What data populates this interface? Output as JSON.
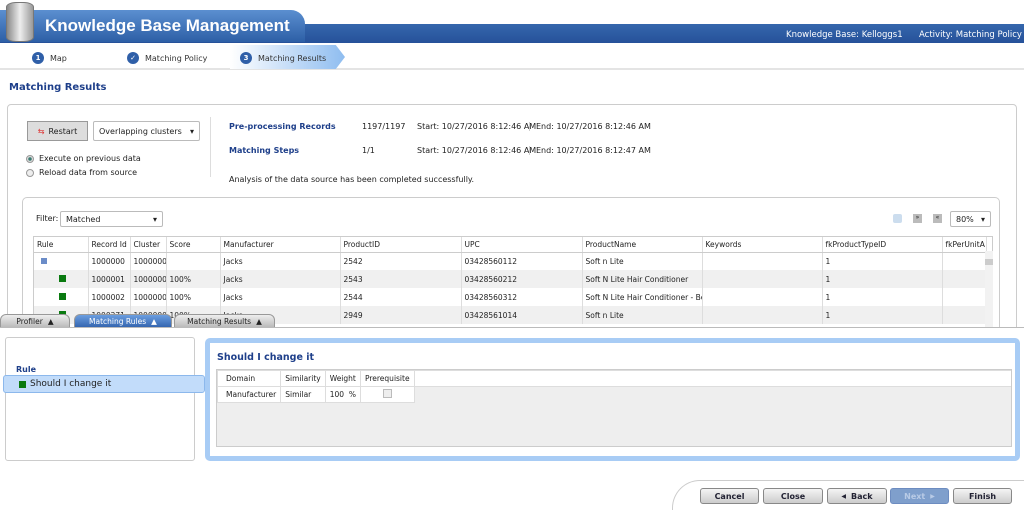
{
  "header": {
    "title": "Knowledge Base Management",
    "knowledge_base": "Knowledge Base: Kelloggs1",
    "activity": "Activity: Matching Policy"
  },
  "steps": [
    {
      "num": "1",
      "label": "Map"
    },
    {
      "num": "✓",
      "label": "Matching Policy"
    },
    {
      "num": "3",
      "label": "Matching Results"
    }
  ],
  "page_title": "Matching Results",
  "controls": {
    "restart": "Restart",
    "cluster_mode": "Overlapping clusters",
    "radio_previous": "Execute on previous data",
    "radio_reload": "Reload data from source"
  },
  "stats": [
    {
      "label": "Pre-processing Records",
      "value": "1197/1197",
      "start": "Start: 10/27/2016 8:12:46 AM",
      "end": "End: 10/27/2016 8:12:46 AM"
    },
    {
      "label": "Matching Steps",
      "value": "1/1",
      "start": "Start: 10/27/2016 8:12:46 AM",
      "end": "End: 10/27/2016 8:12:47 AM"
    }
  ],
  "status_message": "Analysis of the data source has been completed successfully.",
  "grid": {
    "filter_label": "Filter:",
    "filter_value": "Matched",
    "zoom": "80%",
    "columns": [
      "Rule",
      "Record Id",
      "Cluster",
      "Score",
      "Manufacturer",
      "ProductID",
      "UPC",
      "ProductName",
      "Keywords",
      "fkProductTypeID",
      "fkPerUnitA"
    ],
    "rows": [
      [
        "",
        "1000000",
        "1000000",
        "",
        "Jacks",
        "2542",
        "03428560112",
        "Soft n Lite",
        "",
        "1",
        ""
      ],
      [
        "",
        "1000001",
        "1000000",
        "100%",
        "Jacks",
        "2543",
        "03428560212",
        "Soft N Lite Hair Conditioner",
        "",
        "1",
        ""
      ],
      [
        "",
        "1000002",
        "1000000",
        "100%",
        "Jacks",
        "2544",
        "03428560312",
        "Soft N Lite Hair Conditioner - Be",
        "",
        "1",
        ""
      ],
      [
        "",
        "1000271",
        "1000000",
        "100%",
        "Jacks",
        "2949",
        "03428561014",
        "Soft n Lite",
        "",
        "1",
        ""
      ]
    ]
  },
  "bottom_tabs": [
    "Profiler",
    "Matching Rules",
    "Matching Results"
  ],
  "rules": {
    "header": "Rule",
    "selected": "Should I change it",
    "title": "Should I change it",
    "columns": [
      "Domain",
      "Similarity",
      "Weight",
      "Prerequisite"
    ],
    "row": {
      "domain": "Manufacturer",
      "similarity": "Similar",
      "weight": "100",
      "weight_unit": "%"
    }
  },
  "footer": {
    "cancel": "Cancel",
    "close": "Close",
    "back": "Back",
    "next": "Next",
    "finish": "Finish"
  }
}
